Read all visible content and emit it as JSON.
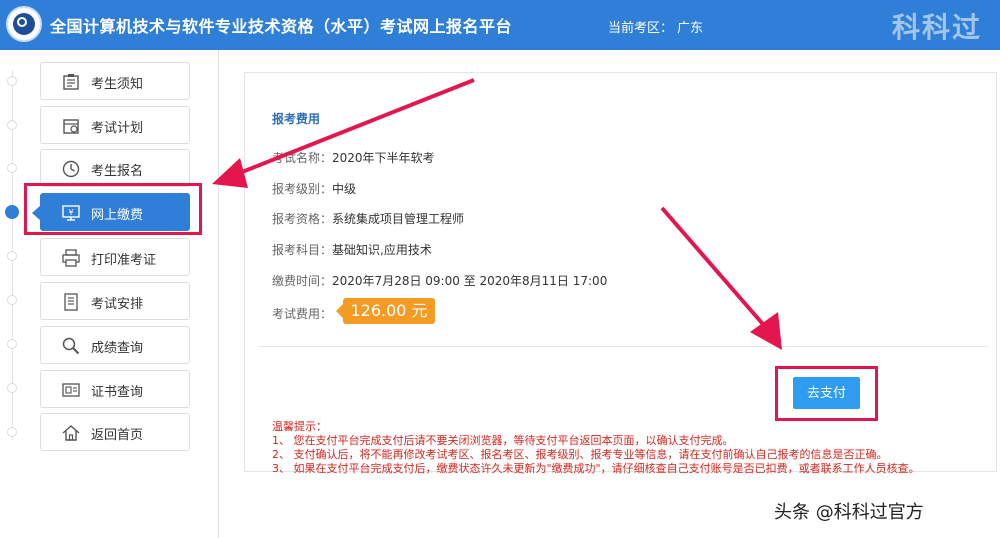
{
  "header": {
    "title": "全国计算机技术与软件专业技术资格（水平）考试网上报名平台",
    "current_region_label": "当前考区：",
    "current_region": "广东",
    "watermark": "科科过"
  },
  "sidebar": {
    "items": [
      {
        "label": "考生须知",
        "icon": "notice-icon"
      },
      {
        "label": "考试计划",
        "icon": "calendar-icon"
      },
      {
        "label": "考生报名",
        "icon": "clock-icon"
      },
      {
        "label": "网上缴费",
        "icon": "monitor-yuan-icon",
        "active": true
      },
      {
        "label": "打印准考证",
        "icon": "printer-icon"
      },
      {
        "label": "考试安排",
        "icon": "document-icon"
      },
      {
        "label": "成绩查询",
        "icon": "magnifier-icon"
      },
      {
        "label": "证书查询",
        "icon": "certificate-icon"
      },
      {
        "label": "返回首页",
        "icon": "home-icon"
      }
    ]
  },
  "main": {
    "section_title": "报考费用",
    "fields": [
      {
        "key": "考试名称：",
        "value": "2020年下半年软考"
      },
      {
        "key": "报考级别：",
        "value": "中级"
      },
      {
        "key": "报考资格：",
        "value": "系统集成项目管理工程师"
      },
      {
        "key": "报考科目：",
        "value": "基础知识,应用技术"
      },
      {
        "key": "缴费时间：",
        "value": "2020年7月28日 09:00 至 2020年8月11日 17:00"
      }
    ],
    "fee_label": "考试费用：",
    "fee_value": "126.00 元",
    "pay_button": "去支付",
    "tips": {
      "title": "温馨提示：",
      "lines": [
        "1、 您在支付平台完成支付后请不要关闭浏览器，等待支付平台返回本页面，以确认支付完成。",
        "2、 支付确认后，将不能再修改考试考区、报名考区、报考级别、报考专业等信息，请在支付前确认自己报考的信息是否正确。",
        "3、 如果在支付平台完成支付后，缴费状态许久未更新为\"缴费成功\"，请仔细核查自己支付账号是否已扣费，或者联系工作人员核查。"
      ]
    }
  },
  "overlay": {
    "watermark_bottom": "头条 @科科过官方",
    "annotation_color": "#e3164f"
  }
}
